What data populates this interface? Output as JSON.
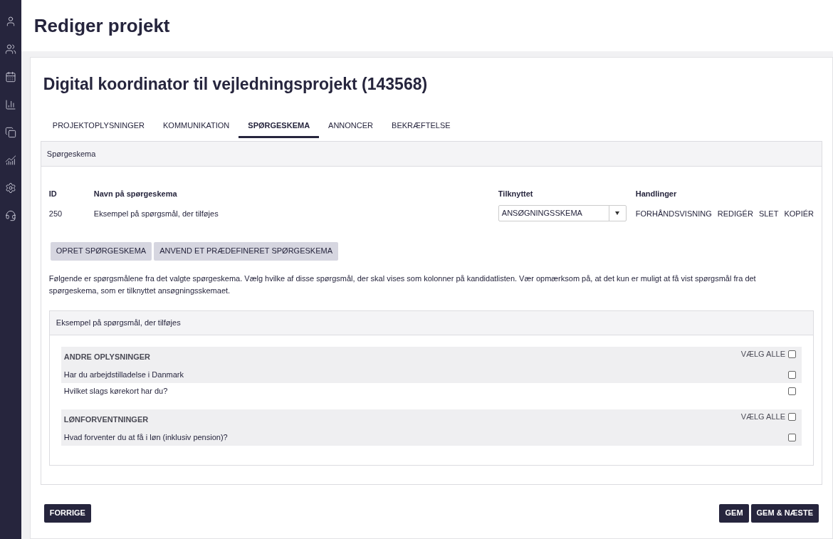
{
  "sidebar": {
    "items": [
      {
        "kind": "person"
      },
      {
        "kind": "group"
      },
      {
        "kind": "calendar"
      },
      {
        "kind": "bars"
      },
      {
        "kind": "copy"
      },
      {
        "kind": "analytics"
      },
      {
        "kind": "settings"
      },
      {
        "kind": "support"
      }
    ]
  },
  "page_title": "Rediger projekt",
  "project_title": "Digital koordinator til vejledningsprojekt (143568)",
  "tabs": [
    {
      "label": "PROJEKTOPLYSNINGER",
      "selected": false
    },
    {
      "label": "KOMMUNIKATION",
      "selected": false
    },
    {
      "label": "SPØRGESKEMA",
      "selected": true
    },
    {
      "label": "ANNONCER",
      "selected": false
    },
    {
      "label": "BEKRÆFTELSE",
      "selected": false
    }
  ],
  "panel": {
    "title": "Spørgeskema",
    "table": {
      "columns": [
        "ID",
        "Navn på spørgeskema",
        "Tilknyttet",
        "Handlinger"
      ],
      "rows": [
        {
          "id": "250",
          "name": "Eksempel på spørgsmål, der tilføjes",
          "linked": "ANSØGNINGSSKEMA",
          "actions": [
            "FORHÅNDSVISNING",
            "REDIGÉR",
            "SLET",
            "KOPIÉR"
          ]
        }
      ]
    },
    "buttons": [
      "OPRET SPØRGESKEMA",
      "ANVEND ET PRÆDEFINERET SPØRGESKEMA"
    ],
    "description": "Følgende er spørgsmålene fra det valgte spørgeskema. Vælg hvilke af disse spørgsmål, der skal vises som kolonner på kandidatlisten. Vær opmærksom på, at det kun er muligt at få vist spørgsmål fra det spørgeskema, som er tilknyttet ansøgningsskemaet.",
    "questionnaire": {
      "title": "Eksempel på spørgsmål, der tilføjes",
      "groups": [
        {
          "title": "ANDRE OPLYSNINGER",
          "select_all_label": "VÆLG ALLE",
          "select_all_checked": false,
          "questions": [
            {
              "text": "Har du arbejdstilladelse i Danmark",
              "checked": false
            },
            {
              "text": "Hvilket slags kørekort har du?",
              "checked": false
            }
          ]
        },
        {
          "title": "LØNFORVENTNINGER",
          "select_all_label": "VÆLG ALLE",
          "select_all_checked": false,
          "questions": [
            {
              "text": "Hvad forventer du at få i løn (inklusiv pension)?",
              "checked": false
            }
          ]
        }
      ]
    }
  },
  "footer": {
    "back": "FORRIGE",
    "save": "GEM",
    "save_next": "GEM & NÆSTE"
  }
}
